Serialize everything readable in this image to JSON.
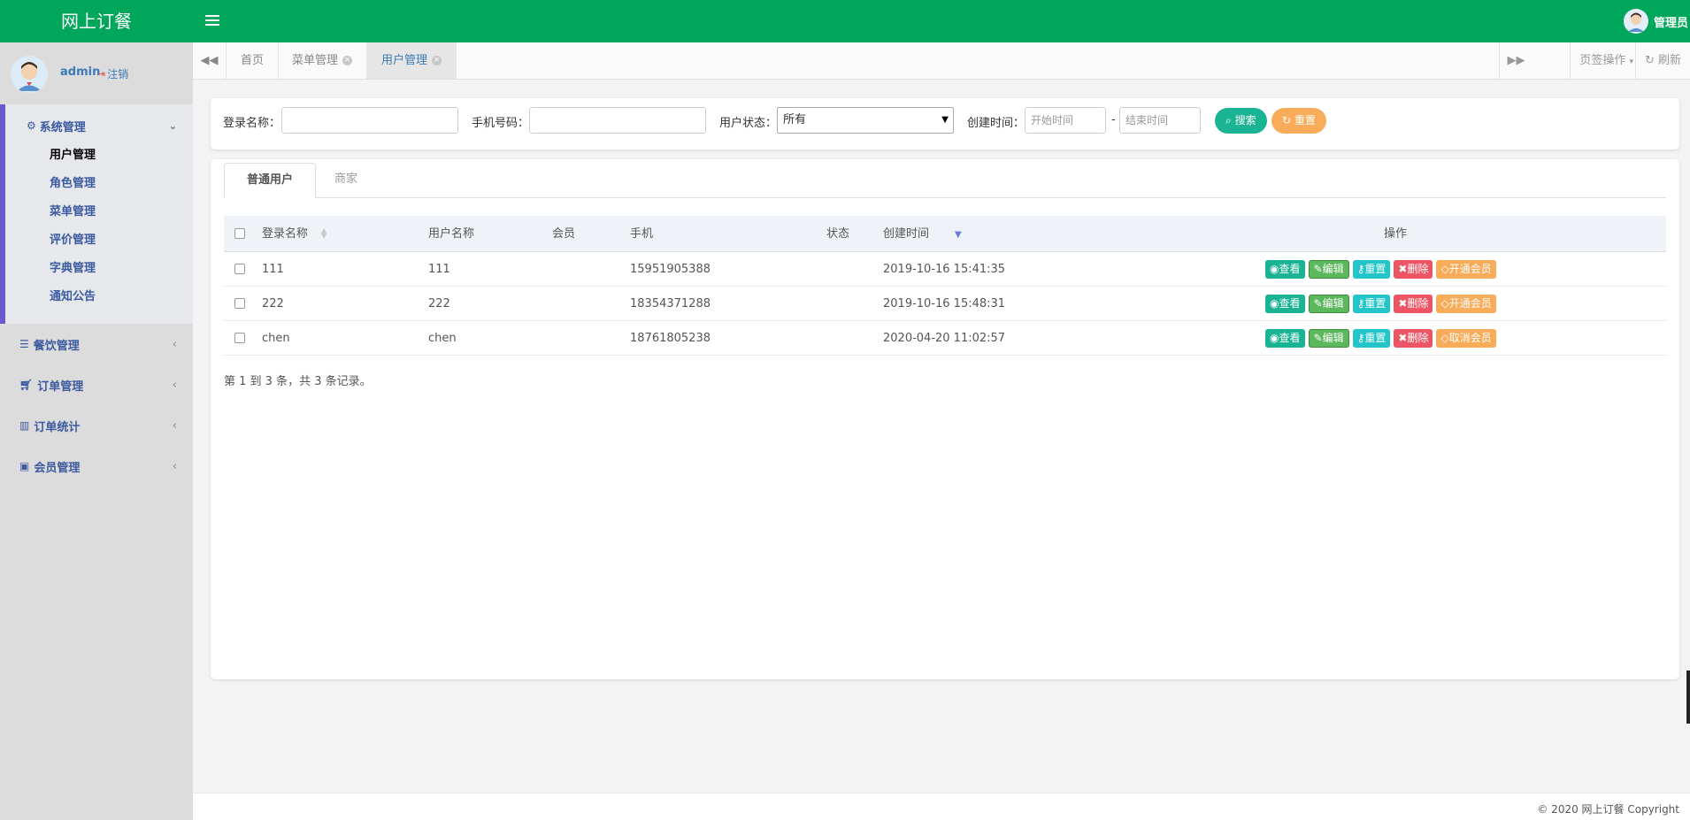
{
  "header": {
    "brand": "网上订餐",
    "user_name": "管理员"
  },
  "sidebar": {
    "profile": {
      "name": "admin",
      "logout_label": "注销"
    },
    "groups": [
      {
        "label": "系统管理",
        "icon": "gear-icon",
        "expanded": true,
        "items": [
          {
            "label": "用户管理",
            "active": true
          },
          {
            "label": "角色管理"
          },
          {
            "label": "菜单管理"
          },
          {
            "label": "评价管理"
          },
          {
            "label": "字典管理"
          },
          {
            "label": "通知公告"
          }
        ]
      },
      {
        "label": "餐饮管理",
        "icon": "list-icon"
      },
      {
        "label": "订单管理",
        "icon": "cart-icon"
      },
      {
        "label": "订单统计",
        "icon": "bar-chart-icon"
      },
      {
        "label": "会员管理",
        "icon": "member-card-icon"
      }
    ]
  },
  "tabstrip": {
    "tabs": [
      {
        "label": "首页"
      },
      {
        "label": "菜单管理",
        "closable": true
      },
      {
        "label": "用户管理",
        "closable": true,
        "active": true
      }
    ],
    "page_ops_label": "页签操作",
    "refresh_label": "刷新"
  },
  "search": {
    "login_name_label": "登录名称：",
    "phone_label": "手机号码：",
    "status_label": "用户状态：",
    "status_value": "所有",
    "created_label": "创建时间：",
    "start_placeholder": "开始时间",
    "end_placeholder": "结束时间",
    "dash": "-",
    "search_button": "搜索",
    "reset_button": "重置"
  },
  "content_tabs": [
    {
      "label": "普通用户",
      "active": true
    },
    {
      "label": "商家"
    }
  ],
  "table": {
    "columns": [
      "登录名称",
      "用户名称",
      "会员",
      "手机",
      "状态",
      "创建时间",
      "操作"
    ],
    "rows": [
      {
        "login": "111",
        "username": "111",
        "vip": "",
        "phone": "15951905388",
        "status": "",
        "created": "2019-10-16 15:41:35",
        "vip_action": "开通会员"
      },
      {
        "login": "222",
        "username": "222",
        "vip": "",
        "phone": "18354371288",
        "status": "",
        "created": "2019-10-16 15:48:31",
        "vip_action": "开通会员"
      },
      {
        "login": "chen",
        "username": "chen",
        "vip": "",
        "phone": "18761805238",
        "status": "",
        "created": "2020-04-20 11:02:57",
        "vip_action": "取消会员"
      }
    ],
    "actions": {
      "view": "查看",
      "edit": "编辑",
      "reset": "重置",
      "delete": "删除"
    },
    "summary": "第 1 到 3 条，共 3 条记录。"
  },
  "footer": {
    "copyright": "© 2020 网上订餐 Copyright"
  },
  "colors": {
    "header_bg": "#00a65a",
    "sidebar_bg": "#dcdcdc",
    "accent_purple": "#6a5acd",
    "btn_primary": "#1ab394",
    "btn_warning": "#f8ac59",
    "btn_success": "#5cb85c",
    "btn_info": "#23c6c8",
    "btn_danger": "#ed5565"
  }
}
